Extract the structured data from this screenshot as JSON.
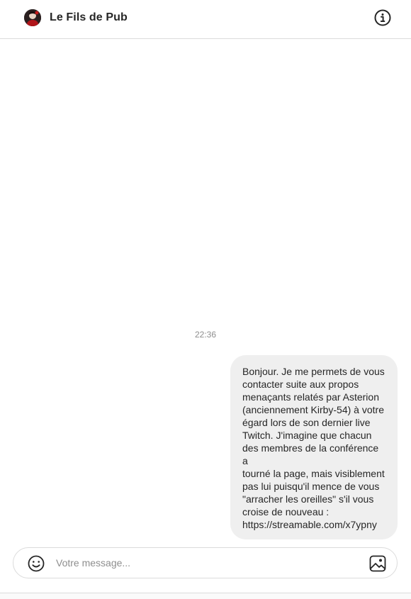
{
  "header": {
    "title": "Le Fils de Pub",
    "avatar_icon": "user-avatar",
    "info_icon": "info-icon"
  },
  "thread": {
    "timestamp": "22:36",
    "messages": [
      {
        "direction": "outgoing",
        "text": "Bonjour. Je me permets de vous\ncontacter suite aux propos\nmenaçants relatés par Asterion\n(anciennement Kirby-54) à votre\négard lors de son dernier live\nTwitch. J'imagine que chacun\ndes membres de la conférence a\ntourné la page, mais visiblement\npas lui puisqu'il mence de vous\n\"arracher les oreilles\" s'il vous\ncroise de nouveau :\nhttps://streamable.com/x7ypny"
      }
    ]
  },
  "composer": {
    "placeholder": "Votre message...",
    "value": "",
    "emoji_icon": "emoji-icon",
    "image_icon": "image-icon"
  },
  "colors": {
    "bubble_bg": "#efefef",
    "border": "#dbdbdb",
    "text": "#262626",
    "muted": "#8e8e8e"
  }
}
